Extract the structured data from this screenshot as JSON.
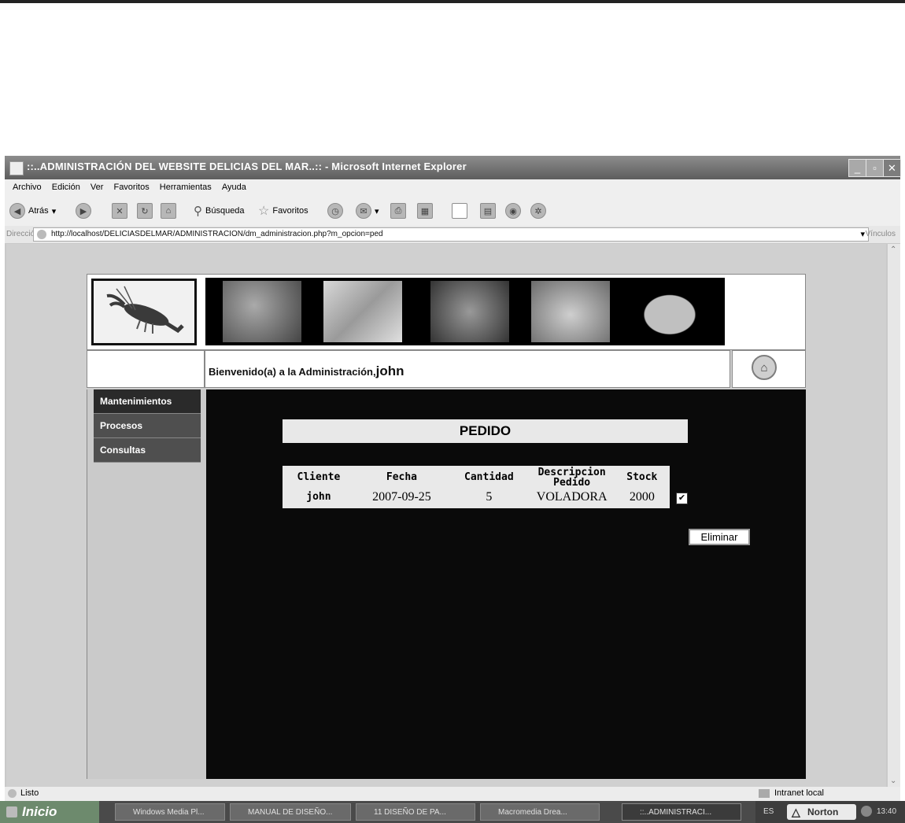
{
  "window": {
    "title": "::..ADMINISTRACIÓN DEL WEBSITE DELICIAS DEL MAR..:: - Microsoft Internet Explorer"
  },
  "menubar": [
    "Archivo",
    "Edición",
    "Ver",
    "Favoritos",
    "Herramientas",
    "Ayuda"
  ],
  "toolbar": {
    "back_label": "Atrás",
    "search_label": "Búsqueda",
    "favorites_label": "Favoritos"
  },
  "address": {
    "label": "Dirección",
    "url": "http://localhost/DELICIASDELMAR/ADMINISTRACION/dm_administracion.php?m_opcion=ped",
    "links_label": "Vínculos"
  },
  "page": {
    "welcome_text": "Bienvenido(a) a la Administración,",
    "welcome_user": "john",
    "sidebar_menu": [
      "Mantenimientos",
      "Procesos",
      "Consultas"
    ],
    "section_title": "PEDIDO",
    "table": {
      "headers": [
        "Cliente",
        "Fecha",
        "Cantidad",
        "Descripcion Pedido",
        "Stock"
      ],
      "rows": [
        [
          "john",
          "2007-09-25",
          "5",
          "VOLADORA",
          "2000"
        ]
      ]
    },
    "delete_button": "Eliminar",
    "row_checked": true
  },
  "status": {
    "left": "Listo",
    "zone": "Intranet local"
  },
  "taskbar": {
    "start": "Inicio",
    "tasks": [
      "Windows Media Pl...",
      "MANUAL DE DISEÑO...",
      "11 DISEÑO DE PA...",
      "Macromedia Drea...",
      "::..ADMINISTRACI..."
    ],
    "lang": "ES",
    "antivirus": "Norton",
    "clock": "13:40"
  }
}
